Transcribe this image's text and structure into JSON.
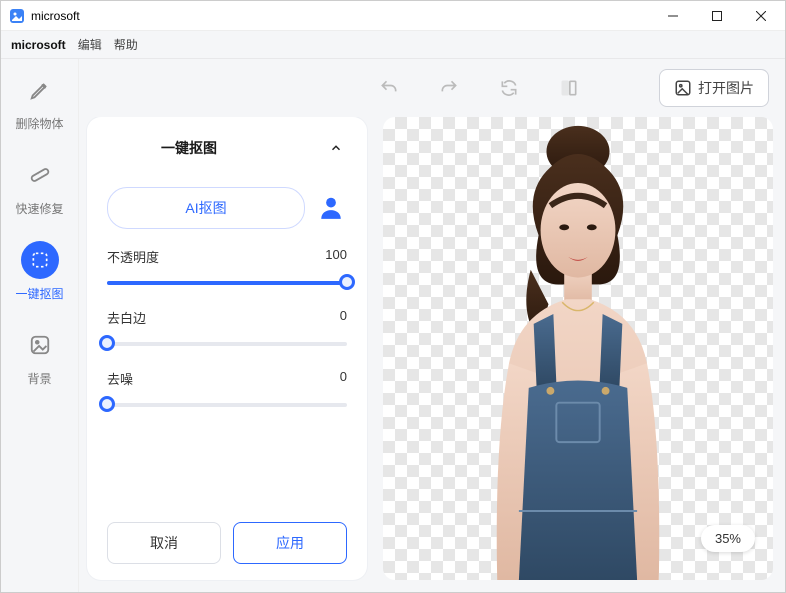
{
  "window": {
    "title": "microsoft"
  },
  "menu": {
    "items": [
      "microsoft",
      "编辑",
      "帮助"
    ],
    "active_index": 0
  },
  "sidebar": {
    "items": [
      {
        "label": "删除物体"
      },
      {
        "label": "快速修复"
      },
      {
        "label": "一键抠图"
      },
      {
        "label": "背景"
      }
    ],
    "active_index": 2
  },
  "topbar": {
    "open_label": "打开图片"
  },
  "panel": {
    "title": "一键抠图",
    "ai_button": "AI抠图",
    "sliders": {
      "opacity": {
        "label": "不透明度",
        "value": 100,
        "max": 100
      },
      "edge": {
        "label": "去白边",
        "value": 0,
        "max": 100
      },
      "denoise": {
        "label": "去噪",
        "value": 0,
        "max": 100
      }
    },
    "cancel": "取消",
    "apply": "应用"
  },
  "canvas": {
    "zoom": "35%"
  }
}
